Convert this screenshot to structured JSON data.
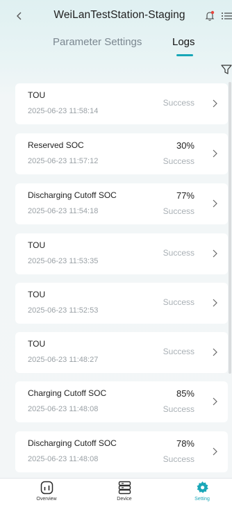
{
  "header": {
    "title": "WeiLanTestStation-Staging",
    "back_icon": "chevron-left-icon",
    "notification_icon": "bell-icon",
    "menu_icon": "list-menu-icon"
  },
  "tabs": [
    {
      "label": "Parameter Settings",
      "active": false
    },
    {
      "label": "Logs",
      "active": true
    }
  ],
  "filter_icon": "filter-icon",
  "logs": [
    {
      "name": "TOU",
      "time": "2025-06-23 11:58:14",
      "value": "",
      "status": "Success"
    },
    {
      "name": "Reserved SOC",
      "time": "2025-06-23 11:57:12",
      "value": "30%",
      "status": "Success"
    },
    {
      "name": "Discharging Cutoff SOC",
      "time": "2025-06-23 11:54:18",
      "value": "77%",
      "status": "Success"
    },
    {
      "name": "TOU",
      "time": "2025-06-23 11:53:35",
      "value": "",
      "status": "Success"
    },
    {
      "name": "TOU",
      "time": "2025-06-23 11:52:53",
      "value": "",
      "status": "Success"
    },
    {
      "name": "TOU",
      "time": "2025-06-23 11:48:27",
      "value": "",
      "status": "Success"
    },
    {
      "name": "Charging Cutoff SOC",
      "time": "2025-06-23 11:48:08",
      "value": "85%",
      "status": "Success"
    },
    {
      "name": "Discharging Cutoff SOC",
      "time": "2025-06-23 11:48:08",
      "value": "78%",
      "status": "Success"
    }
  ],
  "bottom_nav": [
    {
      "label": "Overview",
      "icon": "overview-icon",
      "active": false
    },
    {
      "label": "Device",
      "icon": "device-icon",
      "active": false
    },
    {
      "label": "Setting",
      "icon": "gear-icon",
      "active": true
    }
  ],
  "colors": {
    "accent": "#16a6b7",
    "notification_dot": "#e8453c",
    "status_text": "#a9b0b5"
  }
}
